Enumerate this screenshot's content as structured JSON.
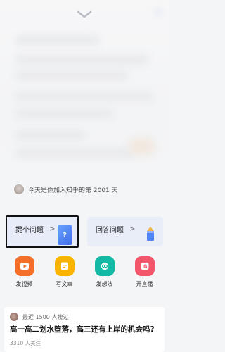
{
  "join_info": {
    "text": "今天是你加入知乎的第 2001 天"
  },
  "cards": {
    "ask": {
      "label": "提个问题",
      "arrow": ">",
      "icon_glyph": "?"
    },
    "answer": {
      "label": "回答问题",
      "arrow": ">"
    }
  },
  "actions": [
    {
      "label": "发视频",
      "icon": "video-icon",
      "color": "#f46f2a"
    },
    {
      "label": "写文章",
      "icon": "article-icon",
      "color": "#f8b400"
    },
    {
      "label": "发想法",
      "icon": "idea-icon",
      "color": "#13b9a5"
    },
    {
      "label": "开直播",
      "icon": "live-icon",
      "color": "#f2566b"
    }
  ],
  "feed": {
    "meta": "最近 1500 人搜过",
    "title": "高一高二划水堕落，高三还有上岸的机会吗?",
    "followers": "3310 人关注"
  }
}
